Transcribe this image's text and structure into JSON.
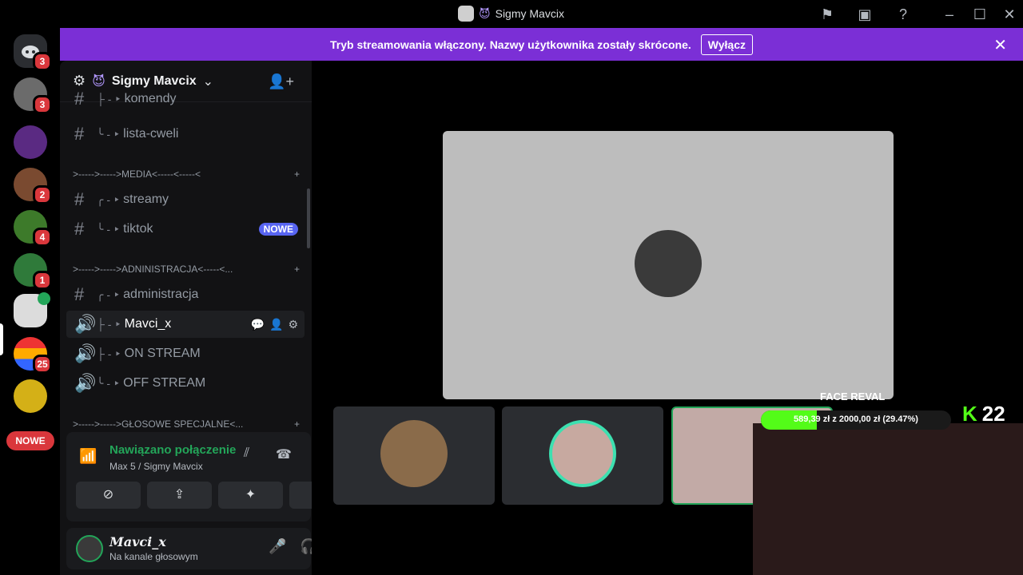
{
  "window": {
    "title": "Sigmy Mavcix"
  },
  "banner": {
    "text": "Tryb streamowania włączony. Nazwy użytkownika zostały skrócone.",
    "button": "Wyłącz"
  },
  "guilds": {
    "home_badge": "3",
    "items": [
      {
        "badge": "3"
      },
      {
        "badge": ""
      },
      {
        "badge": "2"
      },
      {
        "badge": "4"
      },
      {
        "badge": "1"
      },
      {
        "badge": ""
      },
      {
        "badge": "25"
      },
      {
        "badge": ""
      }
    ],
    "nowe": "NOWE"
  },
  "server": {
    "name": "Sigmy Mavcix"
  },
  "channels": [
    {
      "label": "komendy",
      "prefix": "├  - ‣",
      "type": "text"
    },
    {
      "label": "lista-cweli",
      "prefix": "╰  - ‣",
      "type": "text"
    },
    {
      "label": "streamy",
      "prefix": "╭  - ‣",
      "type": "text"
    },
    {
      "label": "tiktok",
      "prefix": "╰  - ‣",
      "type": "text",
      "badge": "NOWE"
    },
    {
      "label": "administracja",
      "prefix": "╭  - ‣",
      "type": "text"
    },
    {
      "label": "Mavci_x",
      "prefix": "├  - ‣",
      "type": "voice"
    },
    {
      "label": "ON STREAM",
      "prefix": "├  - ‣",
      "type": "voice"
    },
    {
      "label": "OFF STREAM",
      "prefix": "╰  - ‣",
      "type": "voice"
    }
  ],
  "categories": [
    {
      "label": ">----->----->MEDIA<-----<-----<"
    },
    {
      "label": ">----->----->ADNINISTRACJA<-----<..."
    },
    {
      "label": ">----->----->GŁOSOWE SPECJALNE<..."
    }
  ],
  "voice_panel": {
    "status": "Nawiązano połączenie",
    "channel": "Max 5 / Sigmy Mavcix"
  },
  "user_panel": {
    "name": "Mavci_x",
    "status": "Na kanale głosowym"
  },
  "overlay": {
    "title": "FACE REVAL",
    "goal_text": "589,39 zł z 2000,00 zł (29.47%)",
    "progress": 0.2947,
    "viewers": "22"
  },
  "colors": {
    "banner": "#7b2fd6",
    "connected": "#23a559",
    "badge": "#da373c",
    "kick_green": "#53fc18"
  }
}
